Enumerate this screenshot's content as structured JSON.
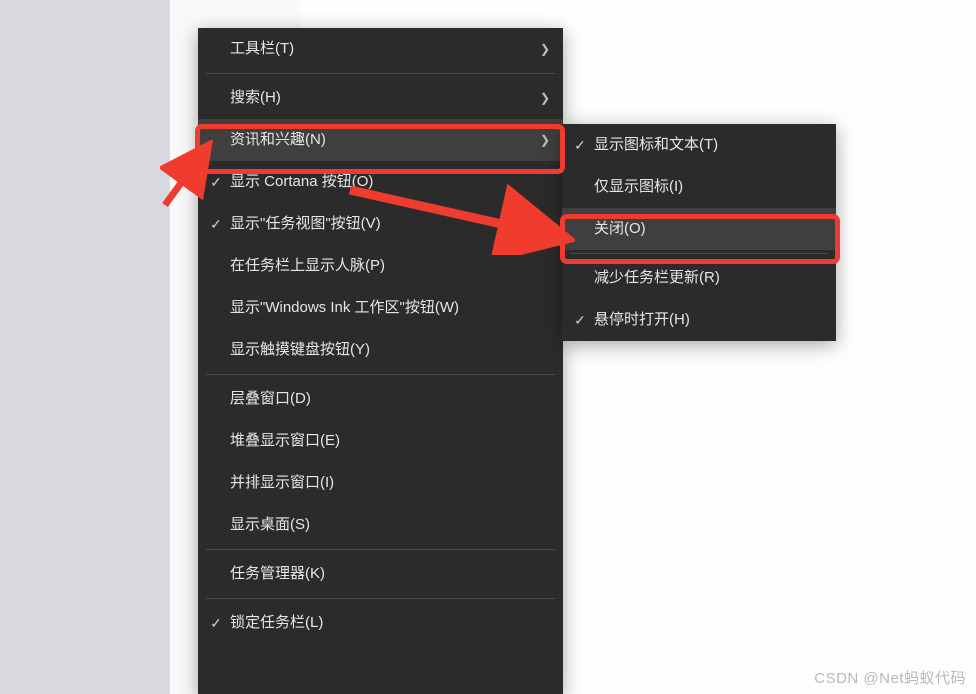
{
  "mainMenu": {
    "items": [
      {
        "label": "工具栏(T)",
        "check": false,
        "submenu": true
      },
      {
        "sep": true
      },
      {
        "label": "搜索(H)",
        "check": false,
        "submenu": true
      },
      {
        "label": "资讯和兴趣(N)",
        "check": false,
        "submenu": true,
        "hover": true
      },
      {
        "label": "显示 Cortana 按钮(O)",
        "check": true,
        "submenu": false
      },
      {
        "label": "显示\"任务视图\"按钮(V)",
        "check": true,
        "submenu": false
      },
      {
        "label": "在任务栏上显示人脉(P)",
        "check": false,
        "submenu": false
      },
      {
        "label": "显示\"Windows Ink 工作区\"按钮(W)",
        "check": false,
        "submenu": false
      },
      {
        "label": "显示触摸键盘按钮(Y)",
        "check": false,
        "submenu": false
      },
      {
        "sep": true
      },
      {
        "label": "层叠窗口(D)",
        "check": false,
        "submenu": false
      },
      {
        "label": "堆叠显示窗口(E)",
        "check": false,
        "submenu": false
      },
      {
        "label": "并排显示窗口(I)",
        "check": false,
        "submenu": false
      },
      {
        "label": "显示桌面(S)",
        "check": false,
        "submenu": false
      },
      {
        "sep": true
      },
      {
        "label": "任务管理器(K)",
        "check": false,
        "submenu": false
      },
      {
        "sep": true
      },
      {
        "label": "锁定任务栏(L)",
        "check": true,
        "submenu": false
      }
    ]
  },
  "subMenu": {
    "items": [
      {
        "label": "显示图标和文本(T)",
        "check": true
      },
      {
        "label": "仅显示图标(I)",
        "check": false
      },
      {
        "label": "关闭(O)",
        "check": false,
        "hover": true
      },
      {
        "sep": true
      },
      {
        "label": "减少任务栏更新(R)",
        "check": false
      },
      {
        "label": "悬停时打开(H)",
        "check": true
      }
    ]
  },
  "watermark": "CSDN @Net蚂蚁代码"
}
